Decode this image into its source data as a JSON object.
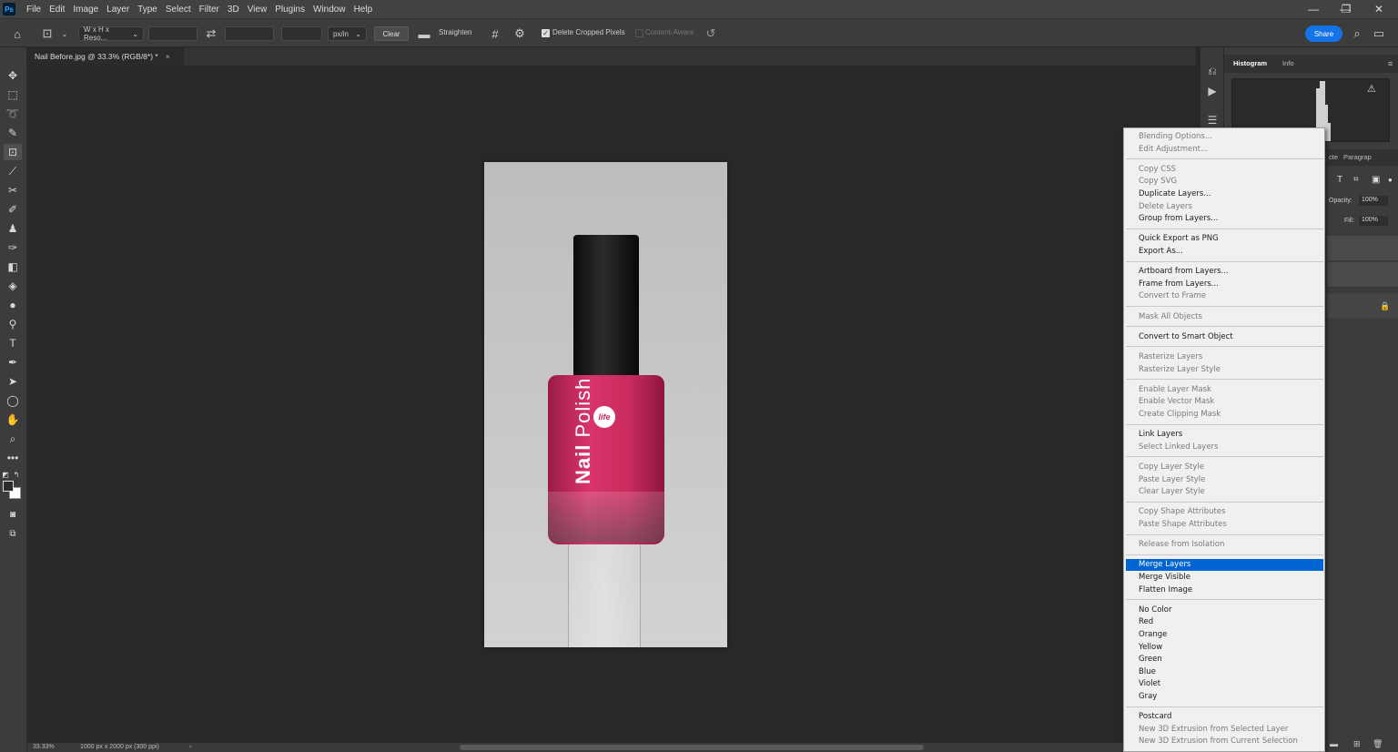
{
  "app": {
    "logo": "Ps"
  },
  "menubar": {
    "items": [
      "File",
      "Edit",
      "Image",
      "Layer",
      "Type",
      "Select",
      "Filter",
      "3D",
      "View",
      "Plugins",
      "Window",
      "Help"
    ]
  },
  "window_controls": {
    "minimize": "—",
    "restore": "❐",
    "close": "✕"
  },
  "options": {
    "ratio_preset": "W x H x Reso...",
    "unit": "px/in",
    "clear": "Clear",
    "straighten": "Straighten",
    "delete_cropped": "Delete Cropped Pixels",
    "content_aware": "Content-Aware",
    "share": "Share"
  },
  "document": {
    "tab_title": "Nail Before.jpg @ 33.3% (RGB/8*) *",
    "close": "×"
  },
  "product": {
    "logo_text": "life",
    "name_bold": "Nail",
    "name_light": "Polish"
  },
  "status": {
    "zoom": "33.33%",
    "doc_info": "1000 px x 2000 px (300 ppi)",
    "arrow": "›"
  },
  "panels": {
    "histogram_tab": "Histogram",
    "info_tab": "Info",
    "char_tab": "cte",
    "para_tab": "Paragrap",
    "opacity_label": "Opacity:",
    "opacity_value": "100%",
    "fill_label": "Fill:",
    "fill_value": "100%"
  },
  "context_menu": {
    "groups": [
      [
        {
          "label": "Blending Options...",
          "enabled": false
        },
        {
          "label": "Edit Adjustment...",
          "enabled": false
        }
      ],
      [
        {
          "label": "Copy CSS",
          "enabled": false
        },
        {
          "label": "Copy SVG",
          "enabled": false
        },
        {
          "label": "Duplicate Layers...",
          "enabled": true
        },
        {
          "label": "Delete Layers",
          "enabled": false
        },
        {
          "label": "Group from Layers...",
          "enabled": true
        }
      ],
      [
        {
          "label": "Quick Export as PNG",
          "enabled": true
        },
        {
          "label": "Export As...",
          "enabled": true
        }
      ],
      [
        {
          "label": "Artboard from Layers...",
          "enabled": true
        },
        {
          "label": "Frame from Layers...",
          "enabled": true
        },
        {
          "label": "Convert to Frame",
          "enabled": false
        }
      ],
      [
        {
          "label": "Mask All Objects",
          "enabled": false
        }
      ],
      [
        {
          "label": "Convert to Smart Object",
          "enabled": true
        }
      ],
      [
        {
          "label": "Rasterize Layers",
          "enabled": false
        },
        {
          "label": "Rasterize Layer Style",
          "enabled": false
        }
      ],
      [
        {
          "label": "Enable Layer Mask",
          "enabled": false
        },
        {
          "label": "Enable Vector Mask",
          "enabled": false
        },
        {
          "label": "Create Clipping Mask",
          "enabled": false
        }
      ],
      [
        {
          "label": "Link Layers",
          "enabled": true
        },
        {
          "label": "Select Linked Layers",
          "enabled": false
        }
      ],
      [
        {
          "label": "Copy Layer Style",
          "enabled": false
        },
        {
          "label": "Paste Layer Style",
          "enabled": false
        },
        {
          "label": "Clear Layer Style",
          "enabled": false
        }
      ],
      [
        {
          "label": "Copy Shape Attributes",
          "enabled": false
        },
        {
          "label": "Paste Shape Attributes",
          "enabled": false
        }
      ],
      [
        {
          "label": "Release from Isolation",
          "enabled": false
        }
      ],
      [
        {
          "label": "Merge Layers",
          "enabled": true,
          "highlighted": true
        },
        {
          "label": "Merge Visible",
          "enabled": true
        },
        {
          "label": "Flatten Image",
          "enabled": true
        }
      ],
      [
        {
          "label": "No Color",
          "enabled": true
        },
        {
          "label": "Red",
          "enabled": true
        },
        {
          "label": "Orange",
          "enabled": true
        },
        {
          "label": "Yellow",
          "enabled": true
        },
        {
          "label": "Green",
          "enabled": true
        },
        {
          "label": "Blue",
          "enabled": true
        },
        {
          "label": "Violet",
          "enabled": true
        },
        {
          "label": "Gray",
          "enabled": true
        }
      ],
      [
        {
          "label": "Postcard",
          "enabled": true
        },
        {
          "label": "New 3D Extrusion from Selected Layer",
          "enabled": false
        },
        {
          "label": "New 3D Extrusion from Current Selection",
          "enabled": false
        }
      ]
    ]
  },
  "colors": {
    "accent": "#1473e6",
    "menu_highlight": "#0065d1",
    "polish": "#d9346a"
  }
}
